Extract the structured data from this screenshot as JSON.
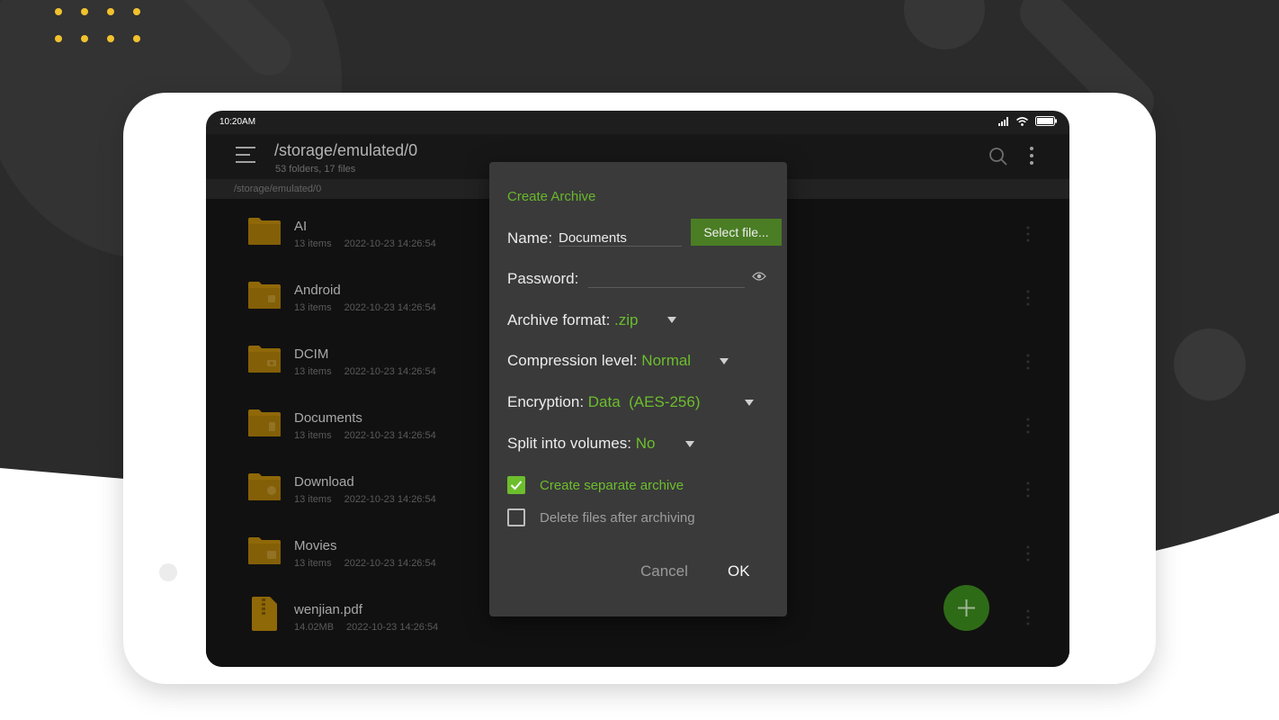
{
  "status_bar": {
    "time": "10:20AM"
  },
  "app_bar": {
    "path": "/storage/emulated/0",
    "summary": "53 folders, 17 files",
    "breadcrumb": "/storage/emulated/0"
  },
  "files": [
    {
      "name": "AI",
      "count": "13 items",
      "date": "2022-10-23 14:26:54",
      "icon": "folder-icon"
    },
    {
      "name": "Android",
      "count": "13 items",
      "date": "2022-10-23 14:26:54",
      "icon": "android-folder-icon"
    },
    {
      "name": "DCIM",
      "count": "13 items",
      "date": "2022-10-23 14:26:54",
      "icon": "camera-folder-icon"
    },
    {
      "name": "Documents",
      "count": "13 items",
      "date": "2022-10-23 14:26:54",
      "icon": "document-folder-icon"
    },
    {
      "name": "Download",
      "count": "13 items",
      "date": "2022-10-23 14:26:54",
      "icon": "download-folder-icon"
    },
    {
      "name": "Movies",
      "count": "13 items",
      "date": "2022-10-23 14:26:54",
      "icon": "video-folder-icon"
    },
    {
      "name": "wenjian.pdf",
      "count": "14.02MB",
      "date": "2022-10-23 14:26:54",
      "icon": "7z-archive-icon"
    }
  ],
  "dialog": {
    "title": "Create Archive",
    "name_label": "Name:",
    "name_value": "Documents",
    "select_file_label": "Select file...",
    "password_label": "Password:",
    "format_label": "Archive format:",
    "format_value": ".zip",
    "compression_label": "Compression level:",
    "compression_value": "Normal",
    "encryption_label": "Encryption:",
    "encryption_value": "Data  (AES-256)",
    "split_label": "Split into volumes:",
    "split_value": "No",
    "separate_label": "Create separate archive",
    "separate_checked": true,
    "delete_label": "Delete files after archiving",
    "delete_checked": false,
    "cancel_label": "Cancel",
    "ok_label": "OK"
  },
  "colors": {
    "accent": "#6cbe2d",
    "dialog_bg": "#3a3a3a",
    "folder": "#b8860b",
    "fab": "#3b8a1e",
    "background_dark": "#2b2b2b",
    "dots": "#f2c12e"
  },
  "icons": {
    "menu": "hamburger-menu-icon",
    "search": "search-icon",
    "more": "more-vertical-icon",
    "eye": "eye-icon",
    "add": "plus-icon"
  }
}
